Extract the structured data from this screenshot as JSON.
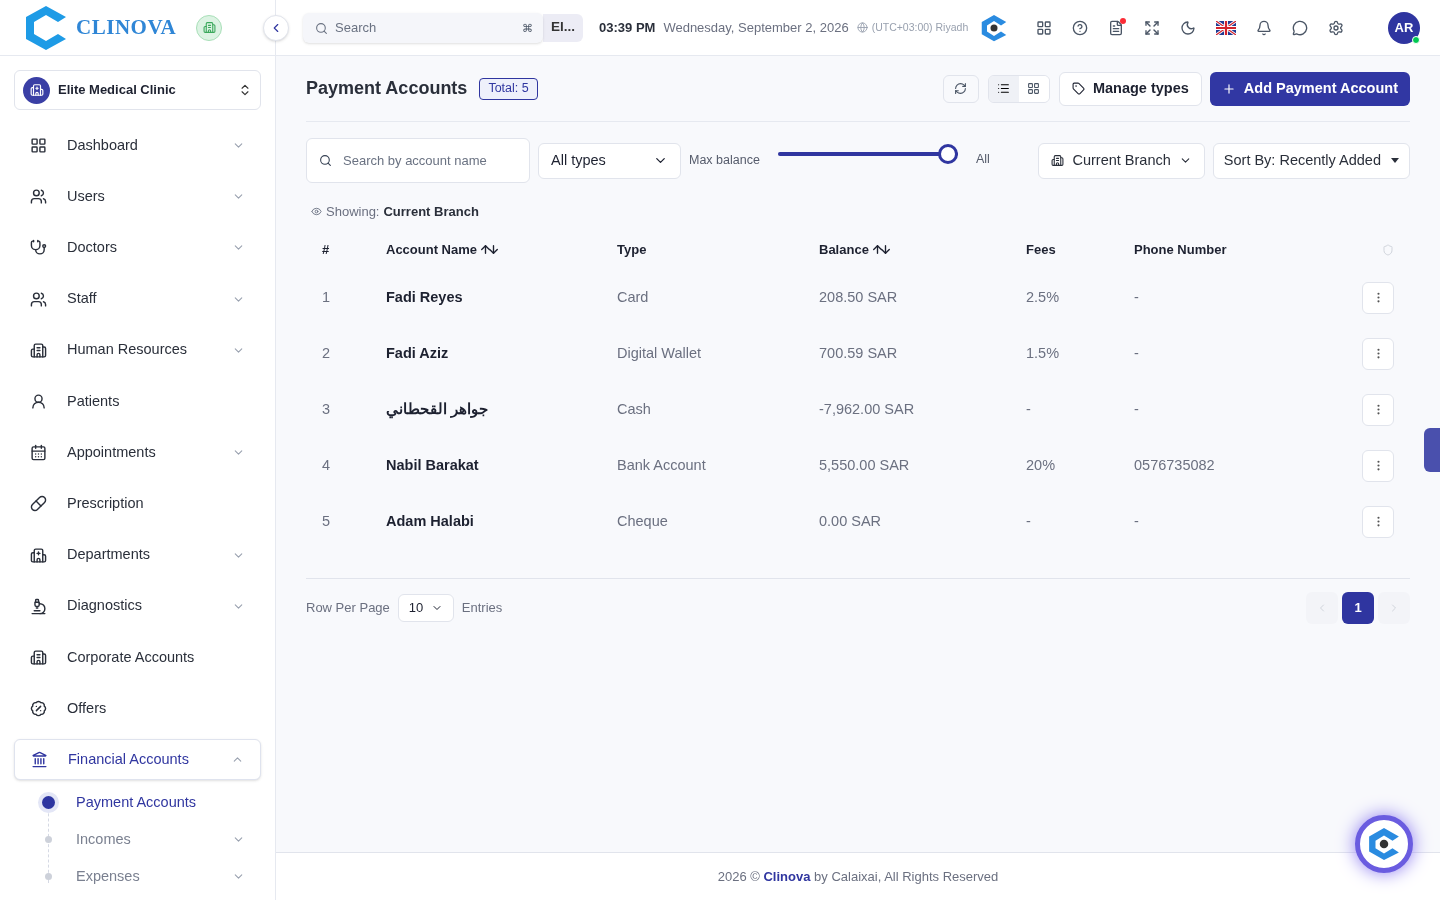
{
  "brand": {
    "name": "CLINOVA"
  },
  "header": {
    "search_placeholder": "Search",
    "shortcut": "⌘",
    "branch_chip": "El...",
    "time": "03:39 PM",
    "date": "Wednesday, September 2, 2026",
    "timezone": "(UTC+03:00) Riyadh",
    "notification_dot": true,
    "avatar": "AR",
    "online": true
  },
  "clinic_selector": {
    "name": "Elite Medical Clinic"
  },
  "sidebar": {
    "items": [
      {
        "label": "Dashboard",
        "expandable": true,
        "expanded": false,
        "selected": false
      },
      {
        "label": "Users",
        "expandable": true,
        "expanded": false,
        "selected": false
      },
      {
        "label": "Doctors",
        "expandable": true,
        "expanded": false,
        "selected": false
      },
      {
        "label": "Staff",
        "expandable": true,
        "expanded": false,
        "selected": false
      },
      {
        "label": "Human Resources",
        "expandable": true,
        "expanded": false,
        "selected": false
      },
      {
        "label": "Patients",
        "expandable": false,
        "selected": false
      },
      {
        "label": "Appointments",
        "expandable": true,
        "expanded": false,
        "selected": false
      },
      {
        "label": "Prescription",
        "expandable": false,
        "selected": false
      },
      {
        "label": "Departments",
        "expandable": true,
        "expanded": false,
        "selected": false
      },
      {
        "label": "Diagnostics",
        "expandable": true,
        "expanded": false,
        "selected": false
      },
      {
        "label": "Corporate Accounts",
        "expandable": false,
        "selected": false
      },
      {
        "label": "Offers",
        "expandable": false,
        "selected": false
      },
      {
        "label": "Financial Accounts",
        "expandable": true,
        "expanded": true,
        "selected": true,
        "children": [
          {
            "label": "Payment Accounts",
            "expandable": false,
            "selected": true
          },
          {
            "label": "Incomes",
            "expandable": true,
            "selected": false
          },
          {
            "label": "Expenses",
            "expandable": true,
            "selected": false
          }
        ]
      }
    ]
  },
  "page": {
    "title": "Payment Accounts",
    "total": "Total: 5",
    "view_list_selected": true,
    "manage_types": "Manage types",
    "add_button": "Add Payment Account"
  },
  "filters": {
    "search_placeholder": "Search by account name",
    "type": "All types",
    "max_balance_label": "Max balance",
    "max_balance": {
      "level": 1.0,
      "reading": "All"
    },
    "branch": "Current Branch",
    "sort_label": "Sort By:",
    "sort_value": "Recently Added"
  },
  "showing": {
    "label": "Showing:",
    "value": "Current Branch"
  },
  "table": {
    "columns": [
      {
        "label": "#",
        "sortable": false
      },
      {
        "label": "Account Name",
        "sortable": true
      },
      {
        "label": "Type",
        "sortable": false
      },
      {
        "label": "Balance",
        "sortable": true
      },
      {
        "label": "Fees",
        "sortable": false
      },
      {
        "label": "Phone Number",
        "sortable": false
      }
    ],
    "rows": [
      {
        "index": "1",
        "name": "Fadi Reyes",
        "type": "Card",
        "balance": "208.50 SAR",
        "fees": "2.5%",
        "phone": "-"
      },
      {
        "index": "2",
        "name": "Fadi Aziz",
        "type": "Digital Wallet",
        "balance": "700.59 SAR",
        "fees": "1.5%",
        "phone": "-"
      },
      {
        "index": "3",
        "name": "جواهر القحطاني",
        "type": "Cash",
        "balance": "-7,962.00 SAR",
        "fees": "-",
        "phone": "-"
      },
      {
        "index": "4",
        "name": "Nabil Barakat",
        "type": "Bank Account",
        "balance": "5,550.00 SAR",
        "fees": "20%",
        "phone": "0576735082"
      },
      {
        "index": "5",
        "name": "Adam Halabi",
        "type": "Cheque",
        "balance": "0.00 SAR",
        "fees": "-",
        "phone": "-"
      }
    ]
  },
  "pagination": {
    "rows_label": "Row Per Page",
    "page_size": "10",
    "entries_label": "Entries",
    "pages": [
      {
        "label": "1",
        "selected": true
      }
    ]
  },
  "footer": {
    "year": "2026 ©",
    "brand": "Clinova",
    "rest": "by Calaixai, All Rights Reserved"
  }
}
